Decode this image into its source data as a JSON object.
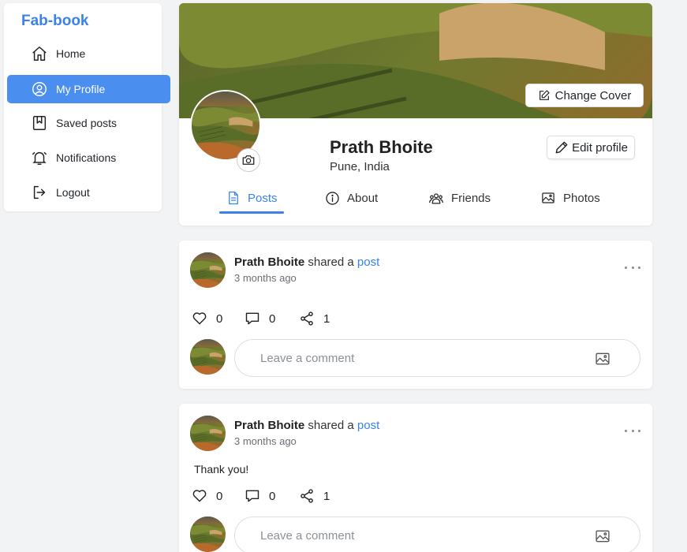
{
  "app": {
    "brand": "Fab-book"
  },
  "sidebar": {
    "items": [
      {
        "label": "Home",
        "icon": "home-icon"
      },
      {
        "label": "My Profile",
        "icon": "user-circle-icon",
        "active": true
      },
      {
        "label": "Saved posts",
        "icon": "bookmark-icon"
      },
      {
        "label": "Notifications",
        "icon": "bell-icon"
      },
      {
        "label": "Logout",
        "icon": "logout-icon"
      }
    ]
  },
  "profile": {
    "change_cover_label": "Change Cover",
    "name": "Prath Bhoite",
    "location": "Pune, India",
    "edit_label": "Edit profile",
    "tabs": [
      {
        "label": "Posts",
        "icon": "document-icon",
        "active": true
      },
      {
        "label": "About",
        "icon": "info-icon"
      },
      {
        "label": "Friends",
        "icon": "users-icon"
      },
      {
        "label": "Photos",
        "icon": "image-icon"
      }
    ]
  },
  "posts": [
    {
      "author": "Prath Bhoite",
      "action_text": "shared a",
      "link_text": "post",
      "time": "3 months ago",
      "text": "",
      "likes": "0",
      "comments": "0",
      "shares": "1",
      "comment_placeholder": "Leave a comment"
    },
    {
      "author": "Prath Bhoite",
      "action_text": "shared a",
      "link_text": "post",
      "time": "3 months ago",
      "text": "Thank you!",
      "likes": "0",
      "comments": "0",
      "shares": "1",
      "comment_placeholder": "Leave a comment"
    }
  ],
  "colors": {
    "accent": "#3b82e8",
    "active_nav_bg": "#4a8ef0",
    "page_bg": "#f2f3f5"
  }
}
